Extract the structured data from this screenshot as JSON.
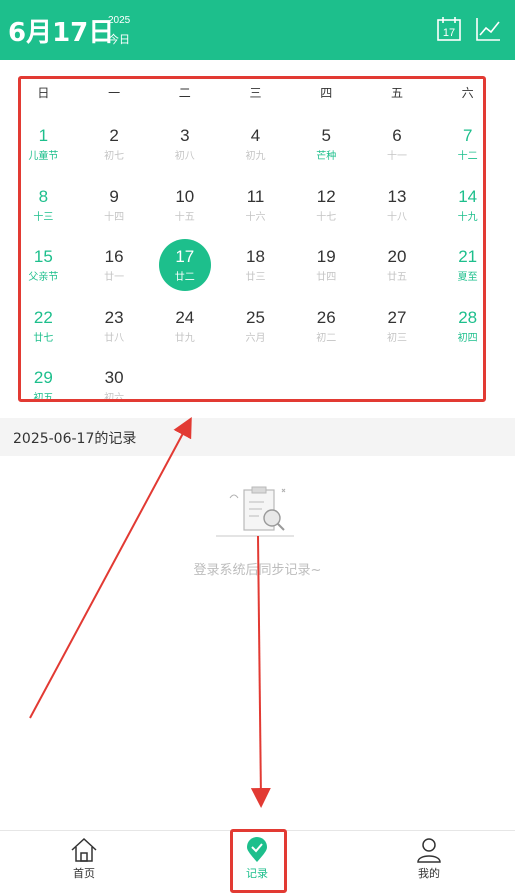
{
  "header": {
    "date": "6月17日",
    "year": "2025",
    "today_label": "今日",
    "calendar_icon_day": "17"
  },
  "calendar": {
    "weekdays": [
      "日",
      "一",
      "二",
      "三",
      "四",
      "五",
      "六"
    ],
    "selected_day": "17",
    "weeks": [
      [
        {
          "day": "1",
          "lunar": "儿童节"
        },
        {
          "day": "2",
          "lunar": "初七"
        },
        {
          "day": "3",
          "lunar": "初八"
        },
        {
          "day": "4",
          "lunar": "初九"
        },
        {
          "day": "5",
          "lunar": "芒种"
        },
        {
          "day": "6",
          "lunar": "十一"
        },
        {
          "day": "7",
          "lunar": "十二"
        }
      ],
      [
        {
          "day": "8",
          "lunar": "十三"
        },
        {
          "day": "9",
          "lunar": "十四"
        },
        {
          "day": "10",
          "lunar": "十五"
        },
        {
          "day": "11",
          "lunar": "十六"
        },
        {
          "day": "12",
          "lunar": "十七"
        },
        {
          "day": "13",
          "lunar": "十八"
        },
        {
          "day": "14",
          "lunar": "十九"
        }
      ],
      [
        {
          "day": "15",
          "lunar": "父亲节"
        },
        {
          "day": "16",
          "lunar": "廿一"
        },
        {
          "day": "17",
          "lunar": "廿二"
        },
        {
          "day": "18",
          "lunar": "廿三"
        },
        {
          "day": "19",
          "lunar": "廿四"
        },
        {
          "day": "20",
          "lunar": "廿五"
        },
        {
          "day": "21",
          "lunar": "夏至"
        }
      ],
      [
        {
          "day": "22",
          "lunar": "廿七"
        },
        {
          "day": "23",
          "lunar": "廿八"
        },
        {
          "day": "24",
          "lunar": "廿九"
        },
        {
          "day": "25",
          "lunar": "六月"
        },
        {
          "day": "26",
          "lunar": "初二"
        },
        {
          "day": "27",
          "lunar": "初三"
        },
        {
          "day": "28",
          "lunar": "初四"
        }
      ],
      [
        {
          "day": "29",
          "lunar": "初五"
        },
        {
          "day": "30",
          "lunar": "初六"
        }
      ]
    ],
    "highlighted_weekday_terms": [
      "芒种"
    ]
  },
  "records": {
    "title": "2025-06-17的记录",
    "empty_text": "登录系统后同步记录~"
  },
  "nav": {
    "items": [
      {
        "label": "首页",
        "icon": "home-icon"
      },
      {
        "label": "记录",
        "icon": "location-check-icon"
      },
      {
        "label": "我的",
        "icon": "user-icon"
      }
    ]
  },
  "colors": {
    "accent": "#1dbf8c",
    "annotation": "#e23a33"
  }
}
